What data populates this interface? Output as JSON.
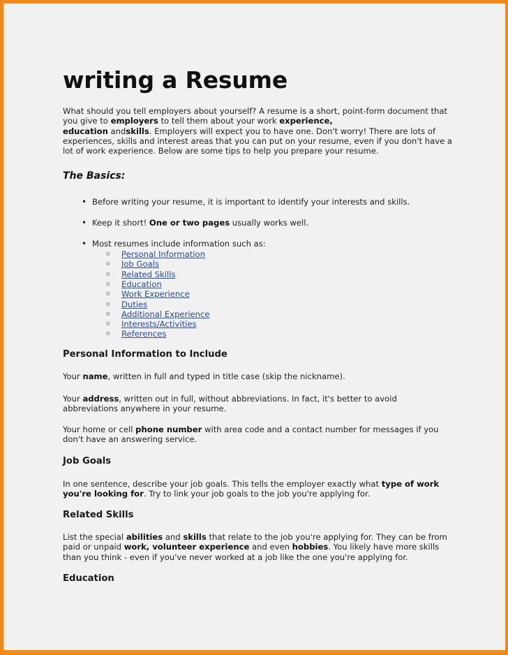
{
  "document": {
    "title": "writing a Resume",
    "intro": {
      "t1": "What should you tell employers about yourself? A resume is a short, point-form document that you give to ",
      "b1": "employers",
      "t2": " to tell them about your work ",
      "b2": "experience,",
      "b3": "education",
      "t3": " and",
      "b4": "skills",
      "t4": ". Employers will expect you to have one. Don't worry! There are lots of experiences, skills and interest areas that you can put on your resume, even if you don't have a lot of work experience. Below are some tips to help you prepare your resume."
    },
    "basics": {
      "heading": "The Basics:",
      "bullet_glyph": "•",
      "sub_bullet_glyph": "o",
      "bullet1": "Before writing your resume, it is important to identify your interests and skills.",
      "bullet2": {
        "t1": "Keep it short! ",
        "b1": "One or two pages",
        "t2": " usually works well."
      },
      "bullet3": "Most resumes include information such as:",
      "links": [
        "Personal Information",
        "Job Goals",
        "Related Skills",
        "Education",
        "Work Experience",
        "Duties",
        "Additional Experience",
        "Interests/Activities",
        "References"
      ]
    },
    "personal_info": {
      "heading": "Personal Information to Include",
      "p1": {
        "t1": "Your ",
        "b1": "name",
        "t2": ", written in full and typed in title case (skip the nickname)."
      },
      "p2": {
        "t1": "Your ",
        "b1": "address",
        "t2": ", written out in full, without abbreviations. In fact, it's better to avoid abbreviations anywhere in your resume."
      },
      "p3": {
        "t1": "Your home or cell ",
        "b1": "phone number",
        "t2": " with area code and a contact number for messages if you don't have an answering service."
      }
    },
    "job_goals": {
      "heading": "Job Goals",
      "p1": {
        "t1": "In one sentence, describe your job goals. This tells the employer exactly what ",
        "b1": "type of work you're looking for",
        "t2": ". Try to link your job goals to the job you're applying for."
      }
    },
    "related_skills": {
      "heading": "Related Skills",
      "p1": {
        "t1": "List the special ",
        "b1": "abilities",
        "t2": " and ",
        "b2": "skills",
        "t3": " that relate to the job you're applying for. They can be from paid or unpaid ",
        "b3": "work, volunteer experience",
        "t4": " and even ",
        "b4": "hobbies",
        "t5": ". You likely have more skills than you think - even if you've never worked at a job like the one you're applying for."
      }
    },
    "education": {
      "heading": "Education"
    },
    "colors": {
      "border": "#ee8a1c",
      "page": "#f1f1f1",
      "link": "#2a4a8c"
    }
  }
}
